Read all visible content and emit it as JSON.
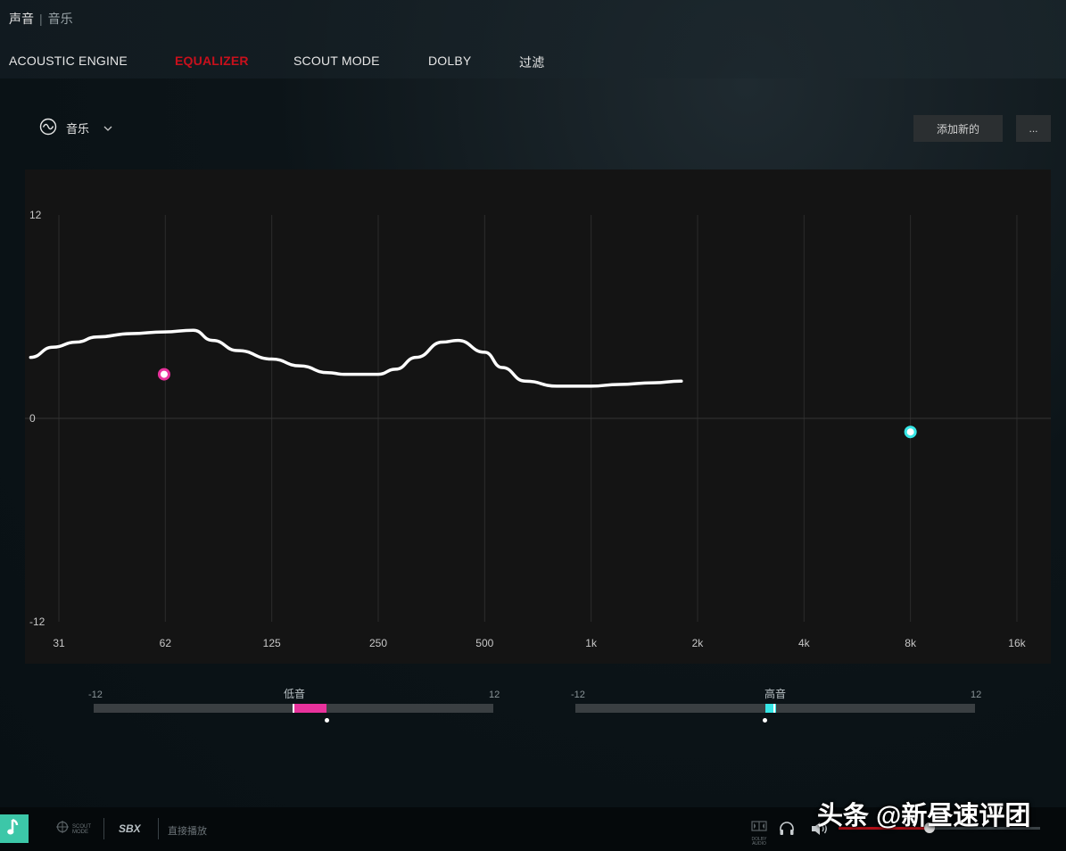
{
  "breadcrumb": {
    "parent": "声音",
    "current": "音乐"
  },
  "tabs": [
    {
      "label": "ACOUSTIC ENGINE",
      "active": false
    },
    {
      "label": "EQUALIZER",
      "active": true
    },
    {
      "label": "SCOUT MODE",
      "active": false
    },
    {
      "label": "DOLBY",
      "active": false
    },
    {
      "label": "过滤",
      "active": false
    }
  ],
  "preset": {
    "icon": "waveform-icon",
    "name": "音乐",
    "dropdown_icon": "chevron-down-icon"
  },
  "buttons": {
    "add_new": "添加新的",
    "more": "..."
  },
  "colors": {
    "accent": "#c8101c",
    "bass": "#e8329c",
    "treble": "#36e6e6",
    "music_button": "#3cc7a8"
  },
  "chart_data": {
    "type": "line",
    "title": "",
    "xscale": "log",
    "x_ticks": [
      "31",
      "62",
      "125",
      "250",
      "500",
      "1k",
      "2k",
      "4k",
      "8k",
      "16k"
    ],
    "y_ticks": [
      "12",
      "0",
      "-12"
    ],
    "ylim": [
      -12,
      12
    ],
    "grid": true,
    "series": [
      {
        "values_hz": [
          26,
          30,
          35,
          40,
          50,
          62,
          75,
          85,
          100,
          125,
          150,
          180,
          200,
          220,
          250,
          280,
          320,
          380,
          420,
          500,
          560,
          650,
          800,
          1000,
          1200,
          1500,
          1800
        ],
        "values_db": [
          3.6,
          4.2,
          4.5,
          4.8,
          5.0,
          5.1,
          5.2,
          4.6,
          4.0,
          3.5,
          3.1,
          2.7,
          2.6,
          2.6,
          2.6,
          2.9,
          3.6,
          4.5,
          4.6,
          3.9,
          3.0,
          2.2,
          1.9,
          1.9,
          2.0,
          2.1,
          2.2
        ]
      }
    ],
    "points": [
      {
        "name": "低音",
        "x_hz": 62,
        "y_db": 2.6,
        "color": "#e8329c"
      },
      {
        "name": "高音",
        "x_hz": 8000,
        "y_db": -0.8,
        "color": "#36e6e6"
      }
    ]
  },
  "bass": {
    "label": "低音",
    "min": "-12",
    "max": "12",
    "value": 2
  },
  "treble": {
    "label": "高音",
    "min": "-12",
    "max": "12",
    "value": 0
  },
  "bottom": {
    "scout_mode": "SCOUT MODE",
    "sbx": "SBX",
    "direct": "直接播放",
    "dolby": "DOLBY AUDIO",
    "volume": 45
  },
  "watermark": "头条 @新昼速评团"
}
